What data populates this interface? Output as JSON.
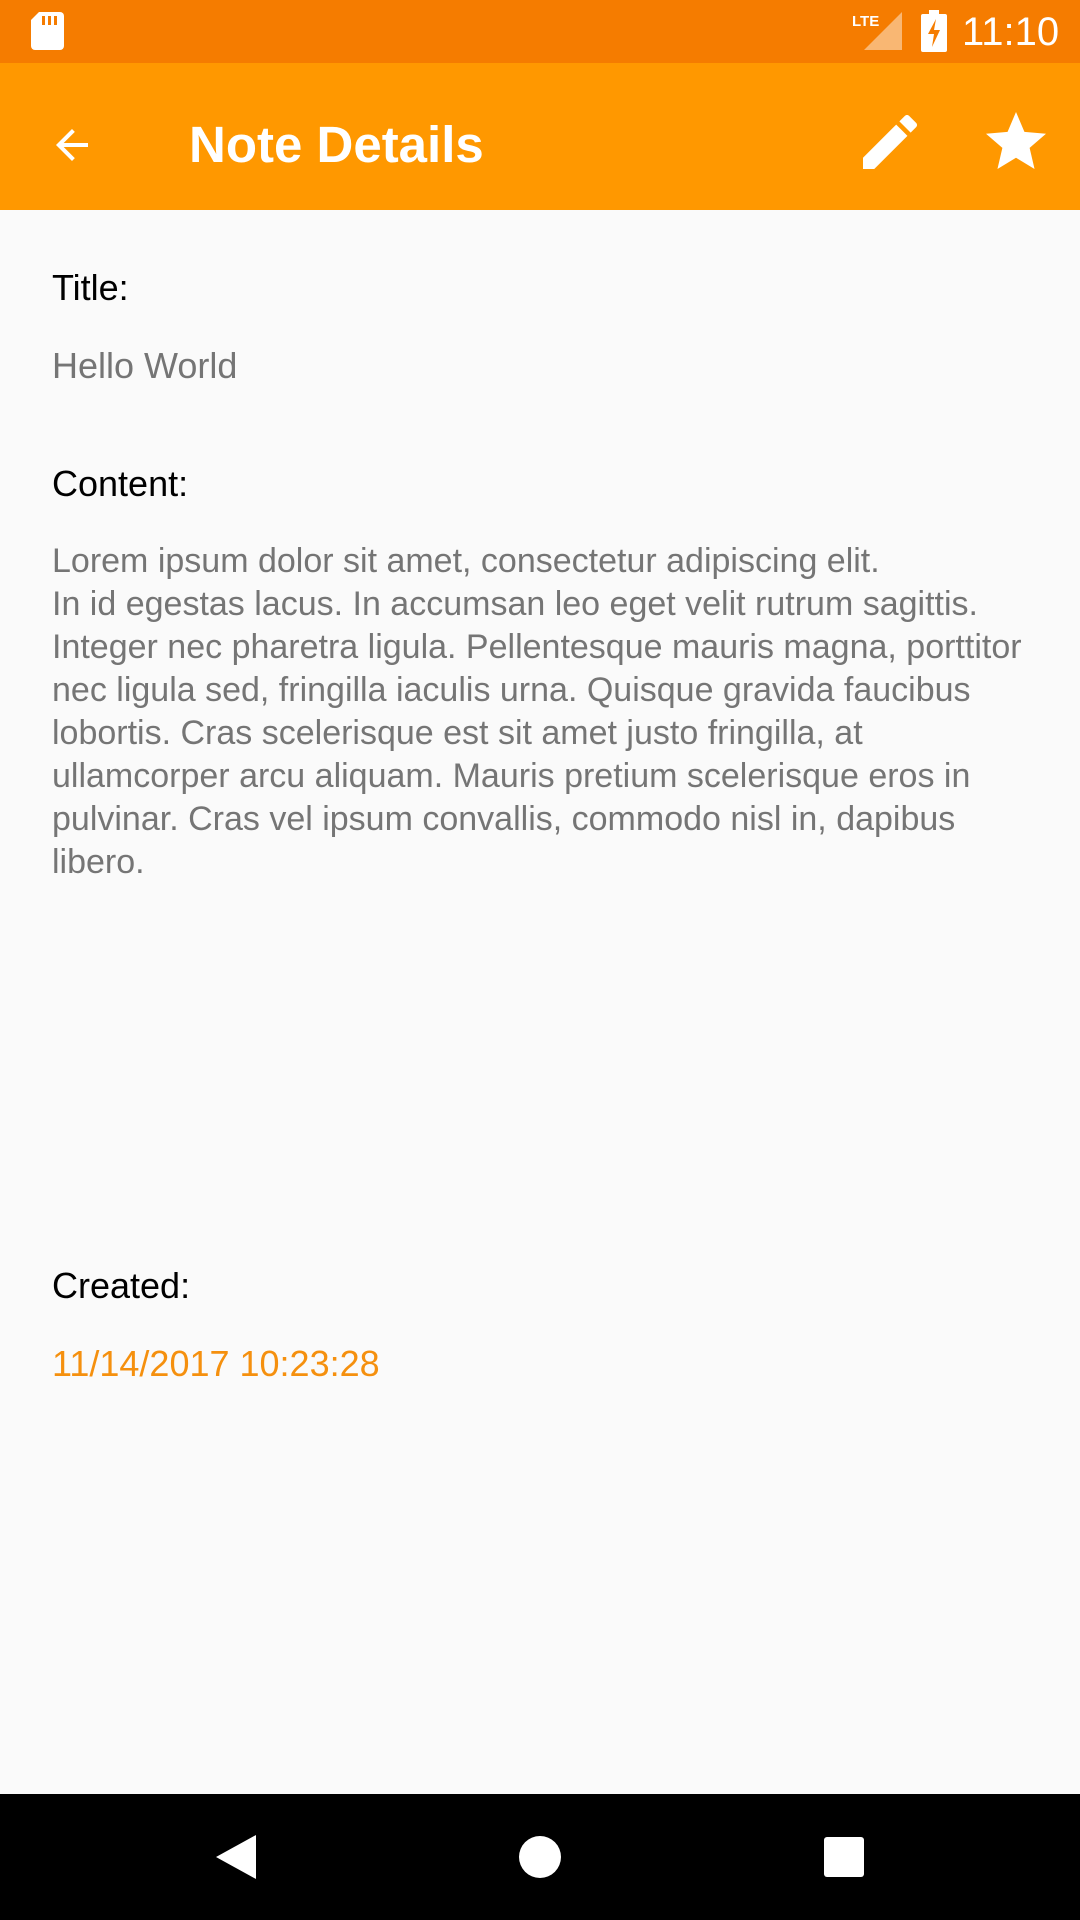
{
  "status_bar": {
    "time": "11:10",
    "network": "LTE",
    "icons": [
      "sd-card-icon",
      "lte-signal-icon",
      "battery-charging-icon"
    ]
  },
  "app_bar": {
    "title": "Note Details",
    "icons": [
      "back-arrow-icon",
      "edit-pencil-icon",
      "star-icon"
    ],
    "color": "#FF9800"
  },
  "note": {
    "title_label": "Title:",
    "title_value": "Hello World",
    "content_label": "Content:",
    "content_value": "Lorem ipsum dolor sit amet, consectetur adipiscing elit.\nIn id egestas lacus. In accumsan leo eget velit rutrum sagittis. Integer nec pharetra ligula. Pellentesque mauris magna, porttitor nec ligula sed, fringilla iaculis urna. Quisque gravida faucibus lobortis. Cras scelerisque est sit amet justo fringilla, at ullamcorper arcu aliquam. Mauris pretium scelerisque eros in pulvinar. Cras vel ipsum convallis, commodo nisl in, dapibus libero.",
    "created_label": "Created:",
    "created_value": "11/14/2017 10:23:28"
  },
  "nav_bar": {
    "icons": [
      "nav-back-icon",
      "nav-home-icon",
      "nav-recents-icon"
    ]
  },
  "colors": {
    "status_bar": "#F57C00",
    "app_bar": "#FF9800",
    "accent": "#F5900E"
  }
}
